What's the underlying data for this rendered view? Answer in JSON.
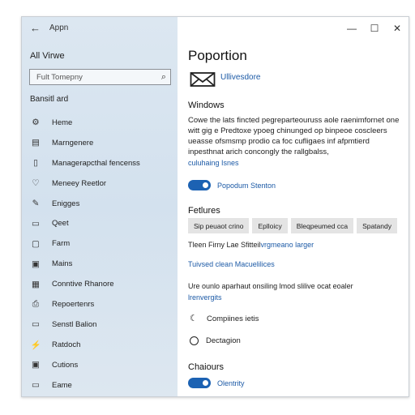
{
  "app": {
    "back_glyph": "←",
    "title": "Appn"
  },
  "window_controls": {
    "minimize": "—",
    "maximize": "☐",
    "close": "✕"
  },
  "sidebar": {
    "heading": "All Virwe",
    "search": {
      "value": "Fult Tomepny",
      "icon": "search-icon"
    },
    "section_label": "Bansitl ard",
    "items": [
      {
        "label": "Heme",
        "icon": "gear-icon",
        "glyph": "⚙"
      },
      {
        "label": "Marngenere",
        "icon": "document-icon",
        "glyph": "▤"
      },
      {
        "label": "Managerapcthal fencenss",
        "icon": "page-icon",
        "glyph": "▯"
      },
      {
        "label": "Meneey Reetlor",
        "icon": "shield-icon",
        "glyph": "♡"
      },
      {
        "label": "Enigges",
        "icon": "pen-icon",
        "glyph": "✎"
      },
      {
        "label": "Qeet",
        "icon": "chat-icon",
        "glyph": "▭"
      },
      {
        "label": "Farm",
        "icon": "file-icon",
        "glyph": "▢"
      },
      {
        "label": "Mains",
        "icon": "mail-icon",
        "glyph": "▣"
      },
      {
        "label": "Conntive Rhanore",
        "icon": "grid-icon",
        "glyph": "▦"
      },
      {
        "label": "Repoertenrs",
        "icon": "printer-icon",
        "glyph": "⎙"
      },
      {
        "label": "Senstl Balion",
        "icon": "window-icon",
        "glyph": "▭"
      },
      {
        "label": "Ratdoch",
        "icon": "bolt-icon",
        "glyph": "⚡"
      },
      {
        "label": "Cutions",
        "icon": "card-icon",
        "glyph": "▣"
      },
      {
        "label": "Eame",
        "icon": "app-icon",
        "glyph": "▭"
      }
    ]
  },
  "main": {
    "title": "Poportion",
    "header_link": "Ullivesdore",
    "windows_heading": "Windows",
    "windows_paragraph": "Cowe the lats fincted pegreparteouruss aole raenimfornet one witt gig e Predtoxe ypoeg chinunged op binpeoe coscleers ueasse ofsmsmp prodio ca foc cufligaes inf afpmtierd inpesthnat arich concongly the rallgbalss,",
    "windows_link": "culuhaing Isnes",
    "toggle1_label": "Popodum Stenton",
    "fetures_heading": "Fetlures",
    "tags": [
      "Sip peuaot crino",
      "Eplloicy",
      "Bleqpeumed cca",
      "Spatandy"
    ],
    "line1_text": "Tleen Firny Lae Sfitteil",
    "line1_link": "vrgmeano larger",
    "line2_link": "Tuivsed clean Macuelilices",
    "para2_text": "Ure ounlo aparhaut onsiling lmod slilive ocat eoaler",
    "para2_link": "lrenvergits",
    "radio1_label": "Compiines ietis",
    "radio2_label": "Dectagion",
    "chairs_heading": "Chaiours",
    "toggle2_label": "Olentrity",
    "accent_color": "#1c62b3",
    "link_color": "#1c5aa6"
  }
}
